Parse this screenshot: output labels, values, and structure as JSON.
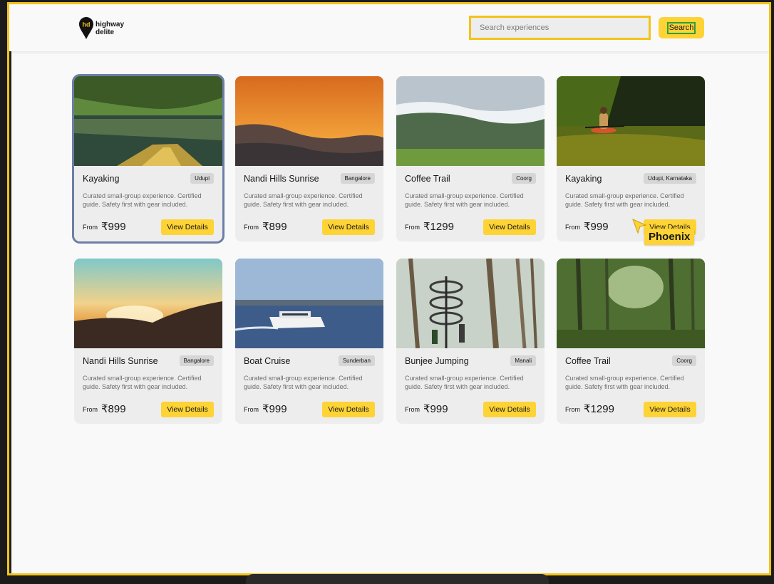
{
  "brand": {
    "line1": "highway",
    "line2": "delite",
    "mark": "hd",
    "accent": "#fdd335"
  },
  "search": {
    "placeholder": "Search experiences",
    "value": "",
    "button_label": "Search"
  },
  "price_prefix": "From",
  "view_label": "View Details",
  "description": "Curated small-group experience. Certified guide. Safety first with gear included.",
  "cards": [
    {
      "title": "Kayaking",
      "location": "Udupi",
      "price": "₹999",
      "image": "mangrove-kayak-image"
    },
    {
      "title": "Nandi Hills Sunrise",
      "location": "Bangalore",
      "price": "₹899",
      "image": "sunrise-hills-image"
    },
    {
      "title": "Coffee Trail",
      "location": "Coorg",
      "price": "₹1299",
      "image": "misty-valley-image"
    },
    {
      "title": "Kayaking",
      "location": "Udupi, Karnataka",
      "price": "₹999",
      "image": "forest-river-kayak-image"
    },
    {
      "title": "Nandi Hills Sunrise",
      "location": "Bangalore",
      "price": "₹899",
      "image": "sunset-hills-image"
    },
    {
      "title": "Boat Cruise",
      "location": "Sunderban",
      "price": "₹999",
      "image": "ferry-boat-image"
    },
    {
      "title": "Bunjee Jumping",
      "location": "Manali",
      "price": "₹999",
      "image": "spiral-stair-tower-image"
    },
    {
      "title": "Coffee Trail",
      "location": "Coorg",
      "price": "₹1299",
      "image": "green-forest-image"
    }
  ],
  "cursor_label": "Phoenix"
}
